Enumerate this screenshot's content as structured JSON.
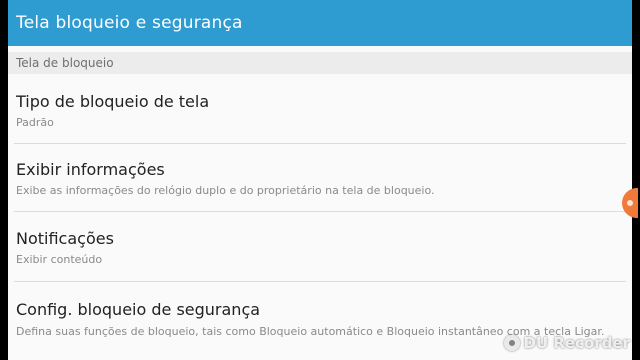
{
  "app_bar": {
    "title": "Tela bloqueio e segurança"
  },
  "section": {
    "header": "Tela de bloqueio"
  },
  "items": [
    {
      "title": "Tipo de bloqueio de tela",
      "subtitle": "Padrão"
    },
    {
      "title": "Exibir informações",
      "subtitle": "Exibe as informações do relógio duplo e do proprietário na tela de bloqueio."
    },
    {
      "title": "Notificações",
      "subtitle": "Exibir conteúdo"
    },
    {
      "title": "Config. bloqueio de segurança",
      "subtitle": "Defina suas funções de bloqueio, tais como Bloqueio automático e Bloqueio instantâneo com a tecla Ligar."
    }
  ],
  "watermark": {
    "text": "DU Recorder",
    "icon": "record-icon"
  },
  "colors": {
    "app_bar": "#2e9bd1",
    "background": "#fafafa",
    "section_header_bg": "#ececec",
    "scroll_handle": "#f07a3a"
  }
}
